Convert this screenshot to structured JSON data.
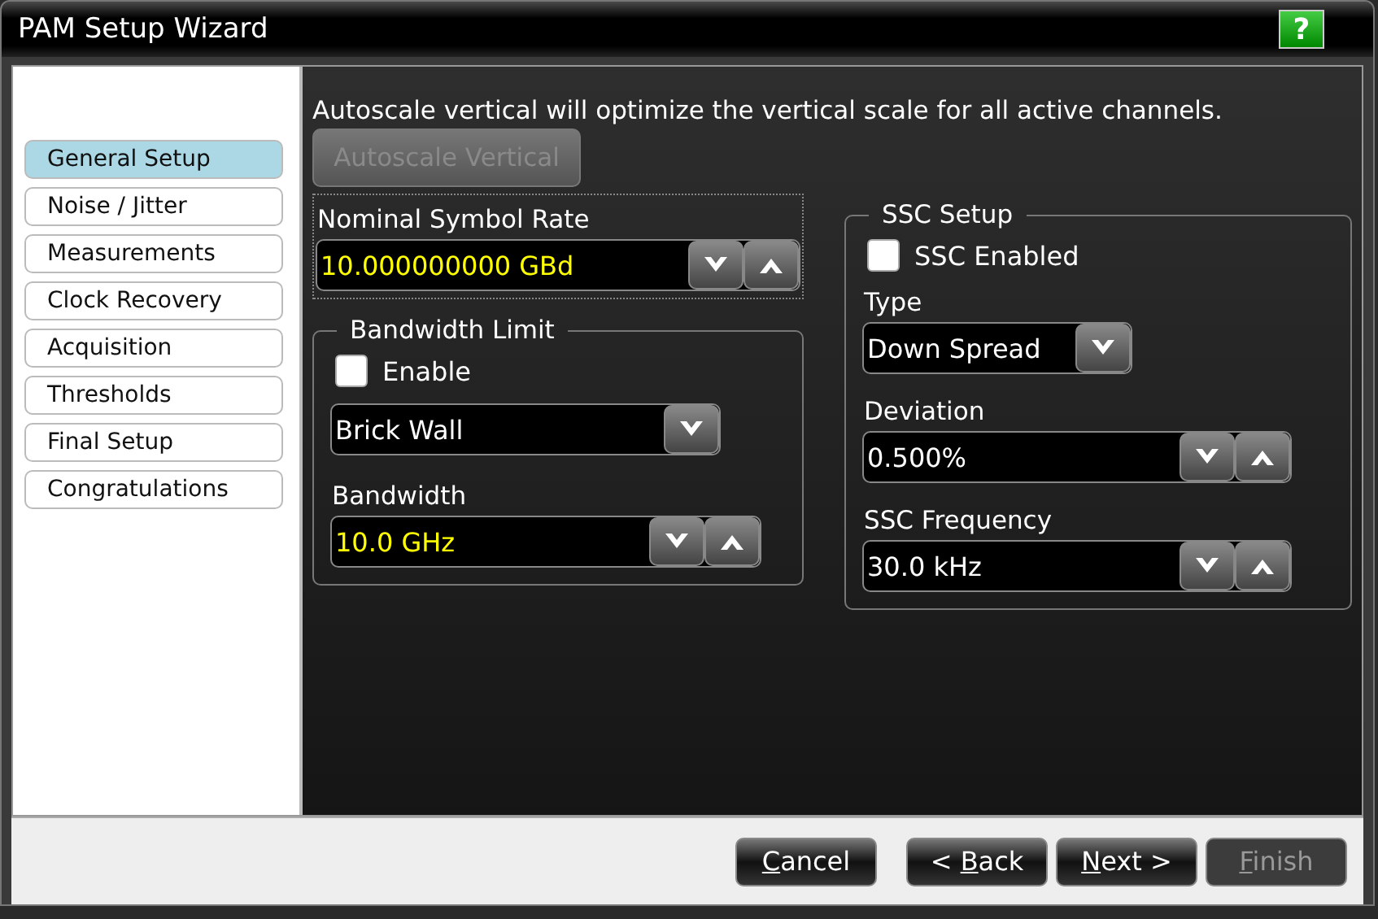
{
  "window": {
    "title": "PAM Setup Wizard",
    "help": "?"
  },
  "steps": [
    {
      "label": "General Setup",
      "selected": true
    },
    {
      "label": "Noise / Jitter",
      "selected": false
    },
    {
      "label": "Measurements",
      "selected": false
    },
    {
      "label": "Clock Recovery",
      "selected": false
    },
    {
      "label": "Acquisition",
      "selected": false
    },
    {
      "label": "Thresholds",
      "selected": false
    },
    {
      "label": "Final Setup",
      "selected": false
    },
    {
      "label": "Congratulations",
      "selected": false
    }
  ],
  "description": "Autoscale vertical will optimize the vertical scale for all active channels.",
  "autoscale_button": {
    "label": "Autoscale Vertical",
    "disabled": true
  },
  "symbol_rate": {
    "label": "Nominal Symbol Rate",
    "value": "10.000000000 GBd",
    "highlighted": true
  },
  "bandwidth_limit": {
    "title": "Bandwidth Limit",
    "enable": {
      "label": "Enable",
      "checked": false
    },
    "filter": {
      "value": "Brick Wall"
    },
    "bandwidth": {
      "label": "Bandwidth",
      "value": "10.0 GHz",
      "highlighted": true
    }
  },
  "ssc_setup": {
    "title": "SSC Setup",
    "enabled": {
      "label": "SSC Enabled",
      "checked": false
    },
    "type": {
      "label": "Type",
      "value": "Down Spread"
    },
    "deviation": {
      "label": "Deviation",
      "value": "0.500%",
      "highlighted": false
    },
    "frequency": {
      "label": "SSC Frequency",
      "value": "30.0 kHz",
      "highlighted": false
    }
  },
  "buttons": [
    {
      "key": "C",
      "after": "ancel",
      "disabled": false
    },
    {
      "before": "< ",
      "key": "B",
      "after": "ack",
      "disabled": false
    },
    {
      "key": "N",
      "after": "ext >",
      "disabled": false
    },
    {
      "key": "F",
      "after": "inish",
      "disabled": true
    }
  ]
}
